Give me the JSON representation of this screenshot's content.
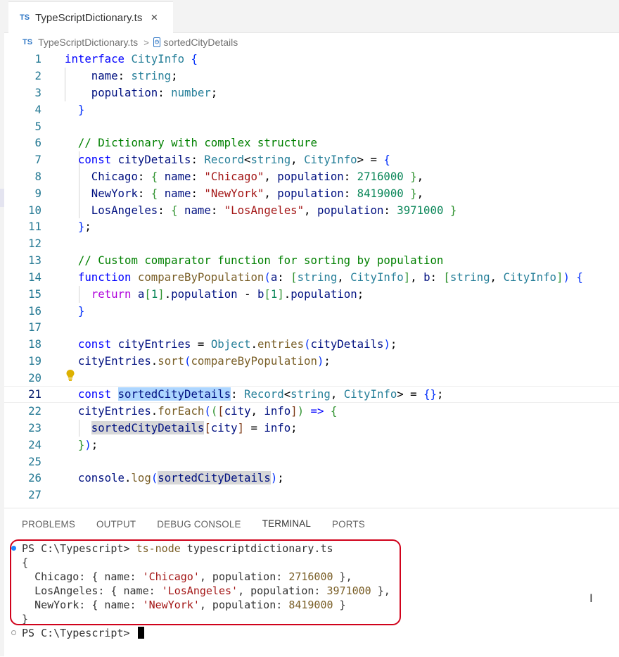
{
  "tab": {
    "badge": "TS",
    "label": "TypeScriptDictionary.ts",
    "close": "×"
  },
  "breadcrumb": {
    "badge": "TS",
    "file": "TypeScriptDictionary.ts",
    "sep": ">",
    "symbol_icon": "[⊖]",
    "symbol": "sortedCityDetails"
  },
  "editor": {
    "active_line": 21,
    "line_numbers": [
      "1",
      "2",
      "3",
      "4",
      "5",
      "6",
      "7",
      "8",
      "9",
      "10",
      "11",
      "12",
      "13",
      "14",
      "15",
      "16",
      "17",
      "18",
      "19",
      "20",
      "21",
      "22",
      "23",
      "24",
      "25",
      "26",
      "27"
    ]
  },
  "panel": {
    "tabs": [
      "PROBLEMS",
      "OUTPUT",
      "DEBUG CONSOLE",
      "TERMINAL",
      "PORTS"
    ],
    "active_tab": "TERMINAL"
  },
  "terminal": {
    "prompt": "PS C:\\Typescript> ",
    "command": "ts-node",
    "command_arg": " typescriptdictionary.ts",
    "output_open": "{",
    "output_close": "}",
    "final_prompt": "PS C:\\Typescript> ",
    "rows": [
      {
        "key": "Chicago",
        "name": "'Chicago'",
        "population": "2716000",
        "trail": " },"
      },
      {
        "key": "LosAngeles",
        "name": "'LosAngeles'",
        "population": "3971000",
        "trail": " },"
      },
      {
        "key": "NewYork",
        "name": "'NewYork'",
        "population": "8419000",
        "trail": " }"
      }
    ]
  },
  "colors": {
    "accent": "#3178c6",
    "highlight_box": "#d0021b"
  },
  "icons": [
    "typescript-file-icon",
    "close-icon",
    "symbol-variable-icon",
    "lightbulb-icon",
    "text-cursor-icon"
  ]
}
